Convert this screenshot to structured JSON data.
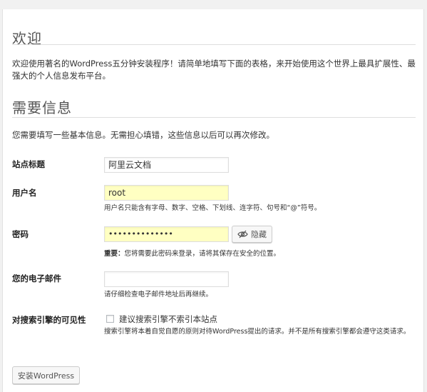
{
  "welcome": {
    "heading": "欢迎",
    "text": "欢迎使用著名的WordPress五分钟安装程序！请简单地填写下面的表格，来开始使用这个世界上最具扩展性、最强大的个人信息发布平台。"
  },
  "info": {
    "heading": "需要信息",
    "text": "您需要填写一些基本信息。无需担心填错，这些信息以后可以再次修改。"
  },
  "form": {
    "site_title": {
      "label": "站点标题",
      "value": "阿里云文档"
    },
    "username": {
      "label": "用户名",
      "value": "root",
      "hint": "用户名只能含有字母、数字、空格、下划线、连字符、句号和“@”符号。"
    },
    "password": {
      "label": "密码",
      "value": "••••••••••••••",
      "toggle_label": "隐藏",
      "hint_strong": "重要：",
      "hint": "您将需要此密码来登录，请将其保存在安全的位置。"
    },
    "email": {
      "label": "您的电子邮件",
      "value": "",
      "hint": "请仔细检查电子邮件地址后再继续。"
    },
    "visibility": {
      "label": "对搜索引擎的可见性",
      "checkbox_label": "建议搜索引擎不索引本站点",
      "checked": false,
      "hint": "搜索引擎将本着自觉自愿的原则对待WordPress提出的请求。并不是所有搜索引擎都会遵守这类请求。"
    }
  },
  "submit_label": "安装WordPress",
  "icons": {
    "toggle": "eye-slash-icon"
  }
}
